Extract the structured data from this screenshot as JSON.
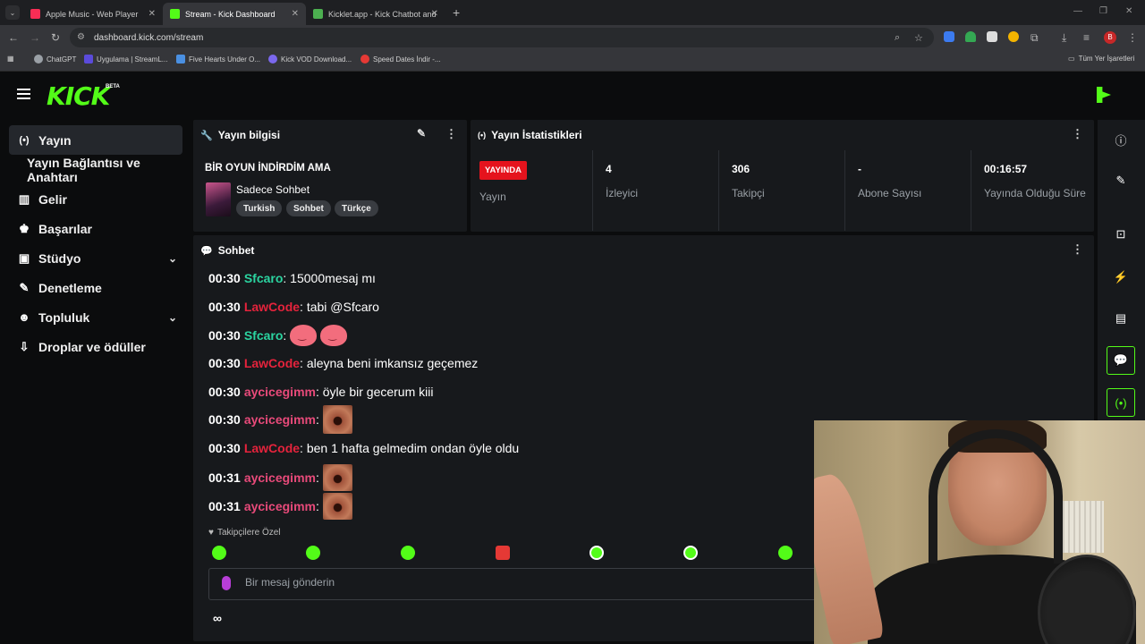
{
  "browser": {
    "tabs": [
      {
        "title": "Apple Music - Web Player",
        "color": "#fa2d55"
      },
      {
        "title": "Stream - Kick Dashboard",
        "color": "#53fc18"
      },
      {
        "title": "Kicklet.app - Kick Chatbot and",
        "color": "#4caf50"
      }
    ],
    "url": "dashboard.kick.com/stream",
    "bookmarks": [
      {
        "label": "ChatGPT",
        "color": "#9aa0a6"
      },
      {
        "label": "Uygulama | StreamL...",
        "color": "#5b4bdb"
      },
      {
        "label": "Five Hearts Under O...",
        "color": "#4a90e2"
      },
      {
        "label": "Kick VOD Download...",
        "color": "#7b68ee"
      },
      {
        "label": "Speed Dates İndir -...",
        "color": "#e53935"
      }
    ],
    "all_bookmarks": "Tüm Yer İşaretleri",
    "profile_initial": "B"
  },
  "app": {
    "logo_text": "KICK",
    "beta": "BETA",
    "accent": "#53fc18"
  },
  "sidebar": {
    "items": [
      {
        "label": "Yayın",
        "icon": "broadcast-icon",
        "glyph": "(•)",
        "active": true
      },
      {
        "label": "Yayın Bağlantısı ve Anahtarı",
        "sub": true
      },
      {
        "label": "Gelir",
        "icon": "chart-icon",
        "glyph": "▥"
      },
      {
        "label": "Başarılar",
        "icon": "trophy-icon",
        "glyph": "🏆"
      },
      {
        "label": "Stüdyo",
        "icon": "studio-icon",
        "glyph": "▣",
        "expandable": true
      },
      {
        "label": "Denetleme",
        "icon": "wrench-icon",
        "glyph": "🔧"
      },
      {
        "label": "Topluluk",
        "icon": "people-icon",
        "glyph": "👥",
        "expandable": true
      },
      {
        "label": "Droplar ve ödüller",
        "icon": "drops-icon",
        "glyph": "⇩"
      }
    ]
  },
  "stream_info": {
    "panel_title": "Yayın bilgisi",
    "title": "BİR OYUN İNDİRDİM AMA",
    "category": "Sadece Sohbet",
    "tags": [
      "Turkish",
      "Sohbet",
      "Türkçe"
    ]
  },
  "stats": {
    "panel_title": "Yayın İstatistikleri",
    "live_badge": "YAYINDA",
    "items": [
      {
        "value": "",
        "label": "Yayın"
      },
      {
        "value": "4",
        "label": "İzleyici"
      },
      {
        "value": "306",
        "label": "Takipçi"
      },
      {
        "value": "-",
        "label": "Abone Sayısı"
      },
      {
        "value": "00:16:57",
        "label": "Yayında Olduğu Süre"
      }
    ]
  },
  "chat": {
    "panel_title": "Sohbet",
    "messages": [
      {
        "time": "00:30",
        "user": "Sfcaro",
        "color": "#2bd4a0",
        "text": "15000mesaj mı",
        "emote": ""
      },
      {
        "time": "00:30",
        "user": "LawCode",
        "color": "#e5233c",
        "text": "tabi @Sfcaro",
        "emote": ""
      },
      {
        "time": "00:30",
        "user": "Sfcaro",
        "color": "#2bd4a0",
        "text": "",
        "emote": "blob2"
      },
      {
        "time": "00:30",
        "user": "LawCode",
        "color": "#e5233c",
        "text": "aleyna beni imkansız geçemez",
        "emote": ""
      },
      {
        "time": "00:30",
        "user": "aycicegimm",
        "color": "#e84a7a",
        "text": "öyle bir gecerum kiii",
        "emote": ""
      },
      {
        "time": "00:30",
        "user": "aycicegimm",
        "color": "#e84a7a",
        "text": "",
        "emote": "face"
      },
      {
        "time": "00:30",
        "user": "LawCode",
        "color": "#e5233c",
        "text": "ben 1 hafta gelmedim ondan öyle oldu",
        "emote": ""
      },
      {
        "time": "00:31",
        "user": "aycicegimm",
        "color": "#e84a7a",
        "text": "",
        "emote": "face"
      },
      {
        "time": "00:31",
        "user": "aycicegimm",
        "color": "#e84a7a",
        "text": "",
        "emote": "face"
      }
    ],
    "followers_only": "Takipçilere Özel",
    "followers_emote_colors": [
      "#53fc18",
      "#53fc18",
      "#53fc18",
      "#e53935",
      "#53fc18",
      "#53fc18",
      "#53fc18"
    ],
    "input_placeholder": "Bir mesaj gönderin"
  }
}
